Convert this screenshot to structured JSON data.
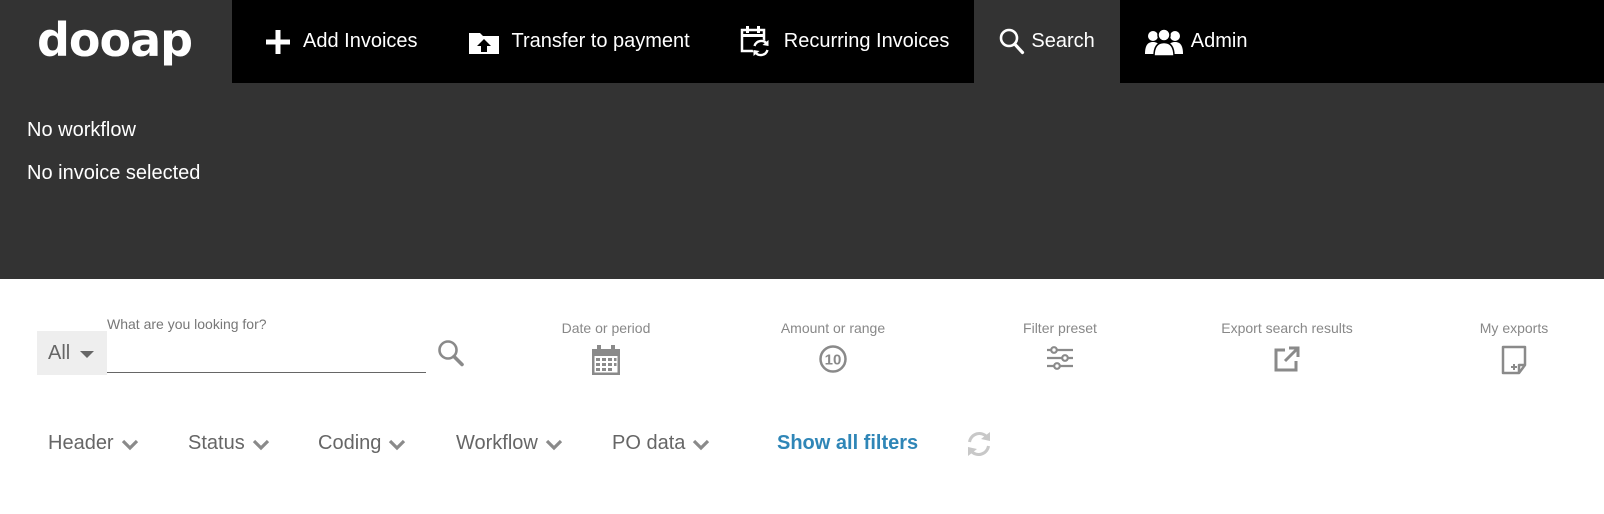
{
  "brand": {
    "logo_text": "dooap"
  },
  "nav": {
    "add_invoices": "Add Invoices",
    "transfer_to_payment": "Transfer to payment",
    "recurring_invoices": "Recurring Invoices",
    "search": "Search",
    "admin": "Admin",
    "active": "search"
  },
  "info": {
    "workflow": "No workflow",
    "invoice": "No invoice selected"
  },
  "search": {
    "scope_value": "All",
    "label": "What are you looking for?",
    "query": "",
    "placeholder": ""
  },
  "tools": {
    "date": "Date or period",
    "amount": "Amount or range",
    "amount_icon_text": "10",
    "preset": "Filter preset",
    "export": "Export search results",
    "my_exports": "My exports"
  },
  "filters": {
    "header": "Header",
    "status": "Status",
    "coding": "Coding",
    "workflow": "Workflow",
    "po_data": "PO data",
    "show_all": "Show all filters"
  },
  "colors": {
    "nav_bg": "#000000",
    "panel_bg": "#333333",
    "link_blue": "#2f86b7",
    "icon_grey": "#888888",
    "text_grey": "#666666"
  }
}
